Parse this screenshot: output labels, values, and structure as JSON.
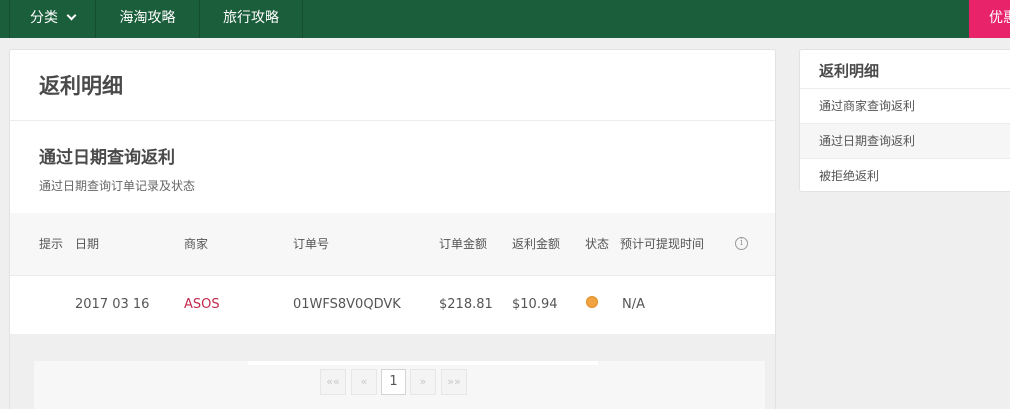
{
  "topnav": {
    "category": "分类",
    "haitao": "海淘攻略",
    "travel": "旅行攻略",
    "promo": "优惠"
  },
  "page": {
    "title": "返利明细",
    "section_title": "通过日期查询返利",
    "section_sub": "通过日期查询订单记录及状态"
  },
  "table": {
    "headers": [
      "提示",
      "日期",
      "商家",
      "订单号",
      "订单金额",
      "返利金额",
      "状态",
      "预计可提现时间"
    ],
    "rows": [
      {
        "hint": "",
        "date": "2017 03 16",
        "merchant": "ASOS",
        "order_no": "01WFS8V0QDVK",
        "amount": "$218.81",
        "rebate": "$10.94",
        "status_color": "#f0a341",
        "withdraw_time": "N/A"
      }
    ]
  },
  "pagination": {
    "first": "««",
    "prev": "«",
    "current": "1",
    "next": "»",
    "last": "»»"
  },
  "sidebar": {
    "title": "返利明细",
    "items": [
      {
        "label": "通过商家查询返利",
        "active": false
      },
      {
        "label": "通过日期查询返利",
        "active": true
      },
      {
        "label": "被拒绝返利",
        "active": false
      }
    ]
  },
  "colors": {
    "nav_bg": "#1b5e3b",
    "promo_bg": "#e8236a",
    "merchant_link": "#c4284c",
    "status_pending": "#f0a341"
  }
}
